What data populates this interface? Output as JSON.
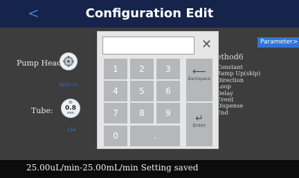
{
  "header": {
    "back_label": "<",
    "title": "Configuration Edit"
  },
  "pump": {
    "label": "Pump Head:",
    "model": "BZ15-13",
    "icon": "pump-head-icon"
  },
  "tube": {
    "label": "Tube:",
    "caption_top": "ID",
    "value": "0.8",
    "unit": "mm",
    "number": "13#"
  },
  "parameter_button": "Parameter>",
  "method": {
    "name": "ethod6",
    "steps": [
      "Constant",
      "Ramp Up(skip)",
      "Direction",
      "Loop",
      "Delay",
      "Event",
      "Dispense",
      "End"
    ]
  },
  "keypad": {
    "input_value": "",
    "close_label": "✕",
    "digits": [
      "1",
      "2",
      "3",
      "4",
      "5",
      "6",
      "7",
      "8",
      "9",
      "0"
    ],
    "dot": ".",
    "backspace_label": "Backspace",
    "enter_label": "Enter"
  },
  "status": {
    "text": "25.00uL/min-25.00mL/min  Setting saved"
  },
  "colors": {
    "header": "#16234a",
    "accent": "#2f74d8",
    "key": "#b5b7ba"
  }
}
